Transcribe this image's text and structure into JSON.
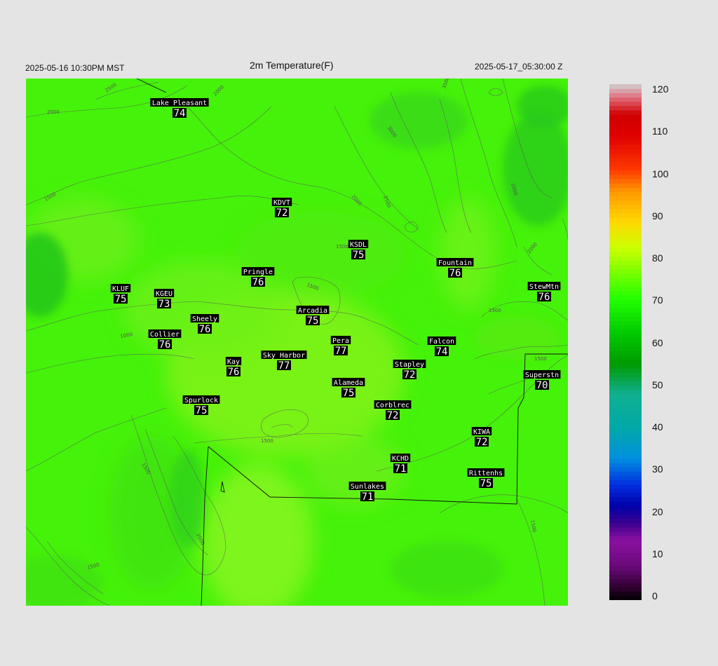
{
  "header": {
    "left": "2025-05-16 10:30PM MST",
    "title": "2m Temperature(F)",
    "right": "2025-05-17_05:30:00 Z"
  },
  "colorbar": {
    "labels": [
      "120",
      "110",
      "100",
      "90",
      "80",
      "70",
      "60",
      "50",
      "40",
      "30",
      "20",
      "10",
      "0"
    ]
  },
  "contour_labels": [
    "2500",
    "2000",
    "2000",
    "1500",
    "3000",
    "3500",
    "2500",
    "2000",
    "2000",
    "1500",
    "1500",
    "1500",
    "1000",
    "2000",
    "1500",
    "1500",
    "1500",
    "2000",
    "1500",
    "1500"
  ],
  "stations": [
    {
      "name": "Lake Pleasant",
      "value": "74"
    },
    {
      "name": "KDVT",
      "value": "72"
    },
    {
      "name": "KSDL",
      "value": "75"
    },
    {
      "name": "Pringle",
      "value": "76"
    },
    {
      "name": "Fountain",
      "value": "76"
    },
    {
      "name": "KLUF",
      "value": "75"
    },
    {
      "name": "KGEU",
      "value": "73"
    },
    {
      "name": "StewMtn",
      "value": "76"
    },
    {
      "name": "Arcadia",
      "value": "75"
    },
    {
      "name": "Sheely",
      "value": "76"
    },
    {
      "name": "Collier",
      "value": "76"
    },
    {
      "name": "Pera",
      "value": "77"
    },
    {
      "name": "Falcon",
      "value": "74"
    },
    {
      "name": "Sky Harbor",
      "value": "77"
    },
    {
      "name": "Kay",
      "value": "76"
    },
    {
      "name": "Stapley",
      "value": "72"
    },
    {
      "name": "Superstn",
      "value": "70"
    },
    {
      "name": "Alameda",
      "value": "75"
    },
    {
      "name": "Spurlock",
      "value": "75"
    },
    {
      "name": "Corblrec",
      "value": "72"
    },
    {
      "name": "KIWA",
      "value": "72"
    },
    {
      "name": "KCHD",
      "value": "71"
    },
    {
      "name": "Rittenhs",
      "value": "75"
    },
    {
      "name": "Sunlakes",
      "value": "71"
    }
  ]
}
